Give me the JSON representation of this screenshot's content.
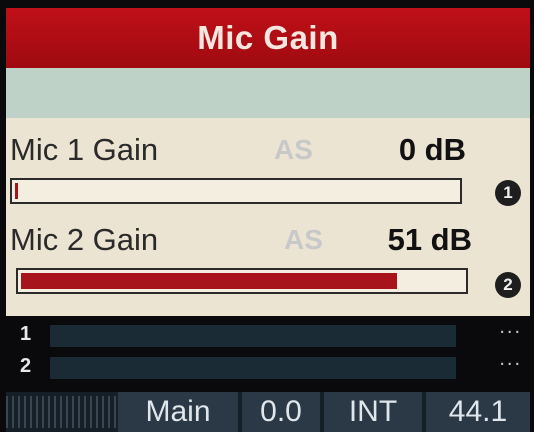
{
  "header": {
    "title": "Mic Gain"
  },
  "channels": [
    {
      "label": "Mic 1 Gain",
      "mode": "AS",
      "value": "0 dB",
      "level": 0.0,
      "knob": "1"
    },
    {
      "label": "Mic 2 Gain",
      "mode": "AS",
      "value": "51 dB",
      "level": 0.85,
      "knob": "2"
    }
  ],
  "meters": [
    {
      "label": "1",
      "menu": "..."
    },
    {
      "label": "2",
      "menu": "..."
    }
  ],
  "status": {
    "bus": "Main",
    "level": "0.0",
    "clock": "INT",
    "rate": "44.1"
  },
  "colors": {
    "accent": "#a8141c",
    "header": "#c01018",
    "panel": "#ece4d2"
  }
}
